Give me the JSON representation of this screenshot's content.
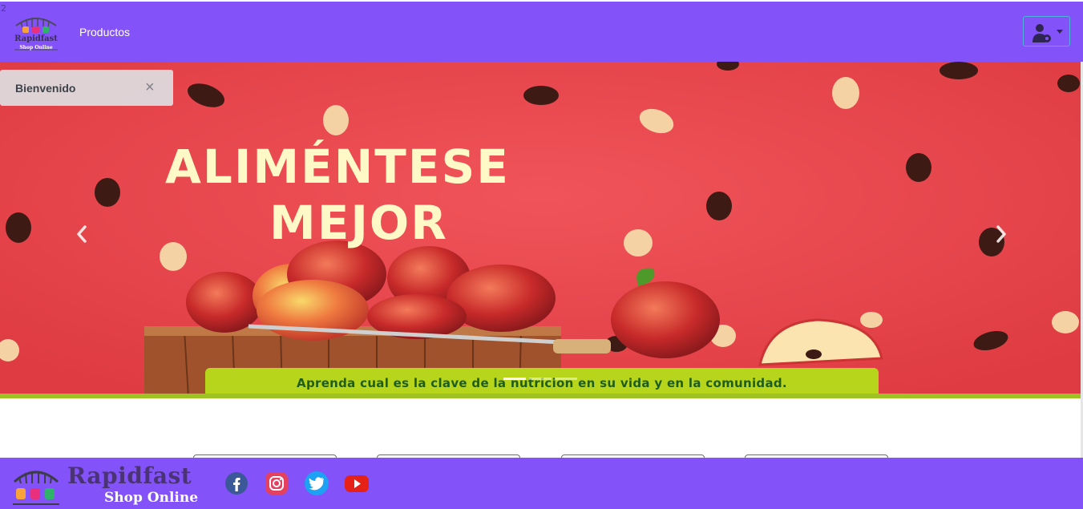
{
  "corner_number": "2",
  "nav": {
    "logo_text": "Rapidfast",
    "logo_subtext": "Shop Online",
    "link_products": "Productos"
  },
  "hero": {
    "title_line1": "ALIMÉNTESE",
    "title_line2": "MEJOR",
    "banner_text": "Aprenda cual es la clave de la nutricion en su vida y en la comunidad.",
    "indicators": 3,
    "active_indicator": 1
  },
  "alert": {
    "message": "Bienvenido",
    "close_symbol": "×"
  },
  "footer": {
    "brand": "Rapidfast",
    "subtitle": "Shop Online",
    "social_icons": [
      "facebook-icon",
      "instagram-icon",
      "twitter-icon",
      "youtube-icon"
    ]
  },
  "colors": {
    "primary": "#8352f8",
    "hero_red": "#e94a4c",
    "banner_green": "#b7d51b",
    "title_cream": "#fff8c7"
  }
}
